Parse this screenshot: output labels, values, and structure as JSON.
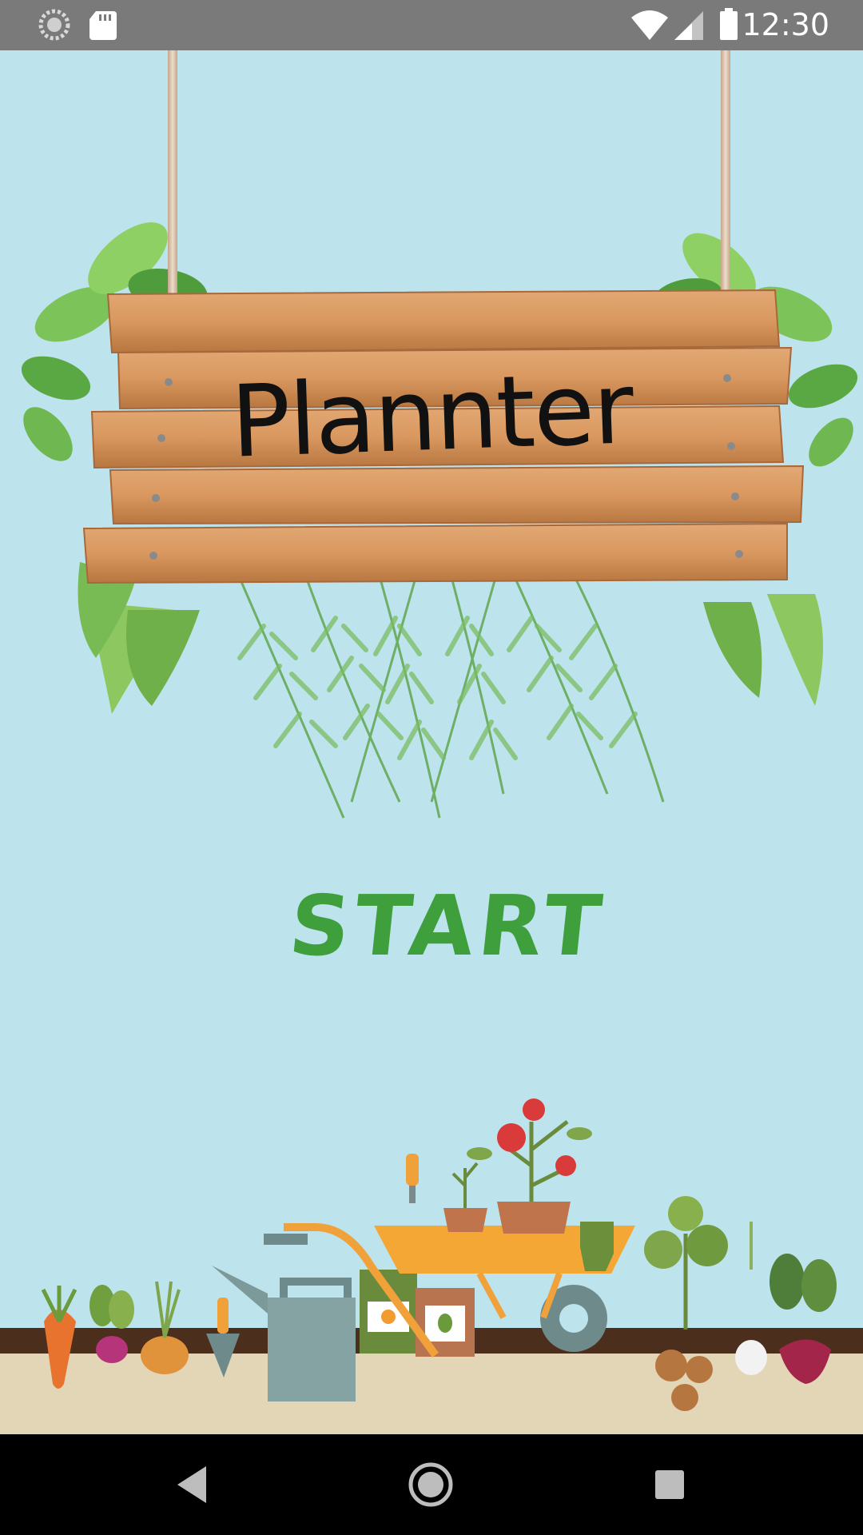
{
  "status_bar": {
    "time": "12:30"
  },
  "sign": {
    "title": "Plannter"
  },
  "start_button": {
    "label": "START"
  },
  "icons": {
    "status_left": [
      "loading-circle-icon",
      "sd-card-icon"
    ],
    "status_right": [
      "wifi-icon",
      "cell-signal-icon",
      "battery-icon"
    ],
    "nav": [
      "back-icon",
      "home-icon",
      "recents-icon"
    ]
  },
  "colors": {
    "background": "#bde3ec",
    "start_text": "#3f9f3c",
    "wood": "#d39462",
    "status_bar": "#7a7a7a"
  }
}
